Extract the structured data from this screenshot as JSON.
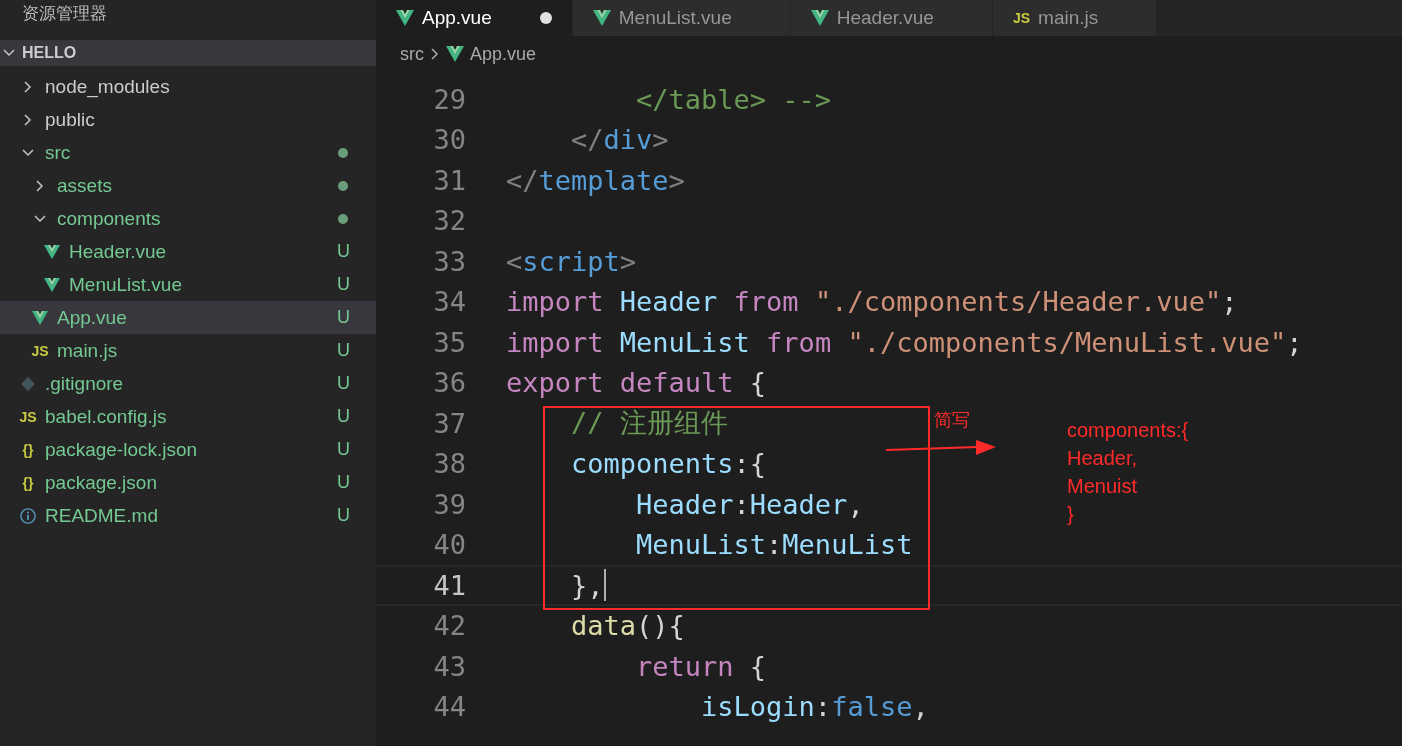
{
  "sidebar": {
    "title": "资源管理器",
    "root": {
      "name": "HELLO",
      "expanded": true
    },
    "items": [
      {
        "name": "node_modules",
        "kind": "folder",
        "expanded": false,
        "selected": false
      },
      {
        "name": "public",
        "kind": "folder",
        "expanded": false,
        "selected": false
      },
      {
        "name": "src",
        "kind": "folder",
        "expanded": true,
        "selected": false,
        "dot": true,
        "children": [
          {
            "name": "assets",
            "kind": "folder",
            "expanded": false,
            "selected": false,
            "dot": true
          },
          {
            "name": "components",
            "kind": "folder",
            "expanded": true,
            "selected": false,
            "dot": true,
            "children": [
              {
                "name": "Header.vue",
                "kind": "vue",
                "selected": false,
                "badge": "U"
              },
              {
                "name": "MenuList.vue",
                "kind": "vue",
                "selected": false,
                "badge": "U"
              }
            ]
          },
          {
            "name": "App.vue",
            "kind": "vue",
            "selected": true,
            "badge": "U"
          },
          {
            "name": "main.js",
            "kind": "js",
            "glyph": "JS",
            "selected": false,
            "badge": "U"
          }
        ]
      },
      {
        "name": ".gitignore",
        "kind": "git",
        "selected": false,
        "badge": "U"
      },
      {
        "name": "babel.config.js",
        "kind": "js",
        "glyph": "JS",
        "selected": false,
        "badge": "U"
      },
      {
        "name": "package-lock.json",
        "kind": "json",
        "glyph": "{}",
        "selected": false,
        "badge": "U"
      },
      {
        "name": "package.json",
        "kind": "json",
        "glyph": "{}",
        "selected": false,
        "badge": "U"
      },
      {
        "name": "README.md",
        "kind": "info",
        "selected": false,
        "badge": "U"
      }
    ]
  },
  "tabs": [
    {
      "label": "App.vue",
      "kind": "vue",
      "selected": true,
      "dirty": true
    },
    {
      "label": "MenuList.vue",
      "kind": "vue",
      "selected": false,
      "dirty": false
    },
    {
      "label": "Header.vue",
      "kind": "vue",
      "selected": false,
      "dirty": false
    },
    {
      "label": "main.js",
      "kind": "js",
      "glyph": "JS",
      "selected": false,
      "dirty": false
    }
  ],
  "breadcrumb": [
    {
      "label": "src",
      "kind": "folder"
    },
    {
      "label": "App.vue",
      "kind": "vue"
    }
  ],
  "code_lines": [
    {
      "number": "29",
      "current": false,
      "tokens": [
        {
          "text": "        </table> -->",
          "kind": "comment"
        }
      ]
    },
    {
      "number": "30",
      "current": false,
      "tokens": [
        {
          "text": "    </",
          "kind": "punct"
        },
        {
          "text": "div",
          "kind": "tag"
        },
        {
          "text": ">",
          "kind": "punct"
        }
      ]
    },
    {
      "number": "31",
      "current": false,
      "tokens": [
        {
          "text": "</",
          "kind": "punct"
        },
        {
          "text": "template",
          "kind": "tag"
        },
        {
          "text": ">",
          "kind": "punct"
        }
      ]
    },
    {
      "number": "32",
      "current": false
    },
    {
      "number": "33",
      "current": false,
      "tokens": [
        {
          "text": "<",
          "kind": "punct"
        },
        {
          "text": "script",
          "kind": "tag"
        },
        {
          "text": ">",
          "kind": "punct"
        }
      ]
    },
    {
      "number": "34",
      "current": false,
      "tokens": [
        {
          "text": "import",
          "kind": "keyword"
        },
        {
          "text": " Header ",
          "kind": "variable"
        },
        {
          "text": "from",
          "kind": "keyword"
        },
        {
          "text": " \"./components/Header.vue\"",
          "kind": "string"
        },
        {
          "text": ";",
          "kind": "plain"
        }
      ]
    },
    {
      "number": "35",
      "current": false,
      "tokens": [
        {
          "text": "import",
          "kind": "keyword"
        },
        {
          "text": " MenuList ",
          "kind": "variable"
        },
        {
          "text": "from",
          "kind": "keyword"
        },
        {
          "text": " \"./components/MenuList.vue\"",
          "kind": "string"
        },
        {
          "text": ";",
          "kind": "plain"
        }
      ]
    },
    {
      "number": "36",
      "current": false,
      "tokens": [
        {
          "text": "export default",
          "kind": "keyword"
        },
        {
          "text": " {",
          "kind": "plain"
        }
      ]
    },
    {
      "number": "37",
      "current": false,
      "tokens": [
        {
          "text": "    // 注册组件",
          "kind": "comment"
        }
      ]
    },
    {
      "number": "38",
      "current": false,
      "tokens": [
        {
          "text": "    components",
          "kind": "variable"
        },
        {
          "text": ":{",
          "kind": "plain"
        }
      ]
    },
    {
      "number": "39",
      "current": false,
      "tokens": [
        {
          "text": "        Header",
          "kind": "variable"
        },
        {
          "text": ":",
          "kind": "plain"
        },
        {
          "text": "Header",
          "kind": "variable"
        },
        {
          "text": ",",
          "kind": "plain"
        }
      ]
    },
    {
      "number": "40",
      "current": false,
      "tokens": [
        {
          "text": "        MenuList",
          "kind": "variable"
        },
        {
          "text": ":",
          "kind": "plain"
        },
        {
          "text": "MenuList",
          "kind": "variable"
        }
      ]
    },
    {
      "number": "41",
      "current": true,
      "tokens": [
        {
          "text": "    },",
          "kind": "plain"
        }
      ]
    },
    {
      "number": "42",
      "current": false,
      "tokens": [
        {
          "text": "    data",
          "kind": "function"
        },
        {
          "text": "(){",
          "kind": "plain"
        }
      ]
    },
    {
      "number": "43",
      "current": false,
      "tokens": [
        {
          "text": "        return",
          "kind": "keyword"
        },
        {
          "text": " {",
          "kind": "plain"
        }
      ]
    },
    {
      "number": "44",
      "current": false,
      "tokens": [
        {
          "text": "            isLogin",
          "kind": "variable"
        },
        {
          "text": ":",
          "kind": "plain"
        },
        {
          "text": "false",
          "kind": "constant"
        },
        {
          "text": ",",
          "kind": "plain"
        }
      ]
    }
  ],
  "annotation": {
    "label": "简写",
    "note": [
      "components:{",
      "Header,",
      "Menuist",
      "}"
    ]
  }
}
